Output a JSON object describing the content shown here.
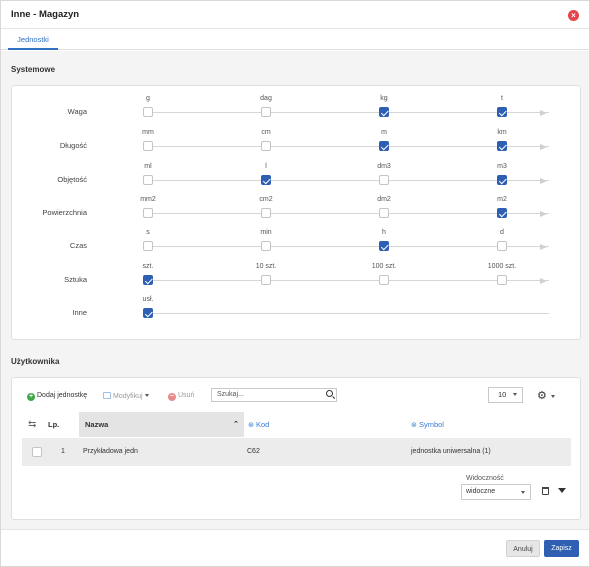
{
  "window": {
    "title": "Inne - Magazyn"
  },
  "tabs": [
    {
      "label": "Jednostki"
    }
  ],
  "systemowe": {
    "title": "Systemowe",
    "rows": [
      {
        "label": "Waga",
        "options": [
          {
            "name": "g",
            "checked": false
          },
          {
            "name": "dag",
            "checked": false
          },
          {
            "name": "kg",
            "checked": true
          },
          {
            "name": "t",
            "checked": true
          }
        ]
      },
      {
        "label": "Długość",
        "options": [
          {
            "name": "mm",
            "checked": false
          },
          {
            "name": "cm",
            "checked": false
          },
          {
            "name": "m",
            "checked": true
          },
          {
            "name": "km",
            "checked": true
          }
        ]
      },
      {
        "label": "Objętość",
        "options": [
          {
            "name": "ml",
            "checked": false
          },
          {
            "name": "l",
            "checked": true
          },
          {
            "name": "dm3",
            "checked": false
          },
          {
            "name": "m3",
            "checked": true
          }
        ]
      },
      {
        "label": "Powierzchnia",
        "options": [
          {
            "name": "mm2",
            "checked": false
          },
          {
            "name": "cm2",
            "checked": false
          },
          {
            "name": "dm2",
            "checked": false
          },
          {
            "name": "m2",
            "checked": true
          }
        ]
      },
      {
        "label": "Czas",
        "options": [
          {
            "name": "s",
            "checked": false
          },
          {
            "name": "min",
            "checked": false
          },
          {
            "name": "h",
            "checked": true
          },
          {
            "name": "d",
            "checked": false
          }
        ]
      },
      {
        "label": "Sztuka",
        "options": [
          {
            "name": "szt.",
            "checked": true
          },
          {
            "name": "10 szt.",
            "checked": false
          },
          {
            "name": "100 szt.",
            "checked": false
          },
          {
            "name": "1000 szt.",
            "checked": false
          }
        ]
      },
      {
        "label": "Inne",
        "options": [
          {
            "name": "usł.",
            "checked": true
          }
        ]
      }
    ]
  },
  "uzytkownika": {
    "title": "Użytkownika",
    "toolbar": {
      "add_label": "Dodaj jednostkę",
      "edit_label": "Modyfikuj",
      "delete_label": "Usuń",
      "search_placeholder": "Szukaj...",
      "page_size": "10"
    },
    "columns": {
      "lp": "Lp.",
      "nazwa": "Nazwa",
      "kod": "Kod",
      "symbol": "Symbol"
    },
    "rows": [
      {
        "lp": "1",
        "nazwa": "Przykładowa jedn",
        "kod": "C62",
        "symbol": "jednostka uniwersalna (1)"
      }
    ],
    "visibility": {
      "label": "Widoczność",
      "value": "widoczne"
    }
  },
  "footer": {
    "cancel_label": "Anuluj",
    "save_label": "Zapisz"
  },
  "colors": {
    "accent": "#2f5fb3",
    "close": "#e5454a",
    "add": "#3aa845",
    "delete": "#e46a6a"
  }
}
